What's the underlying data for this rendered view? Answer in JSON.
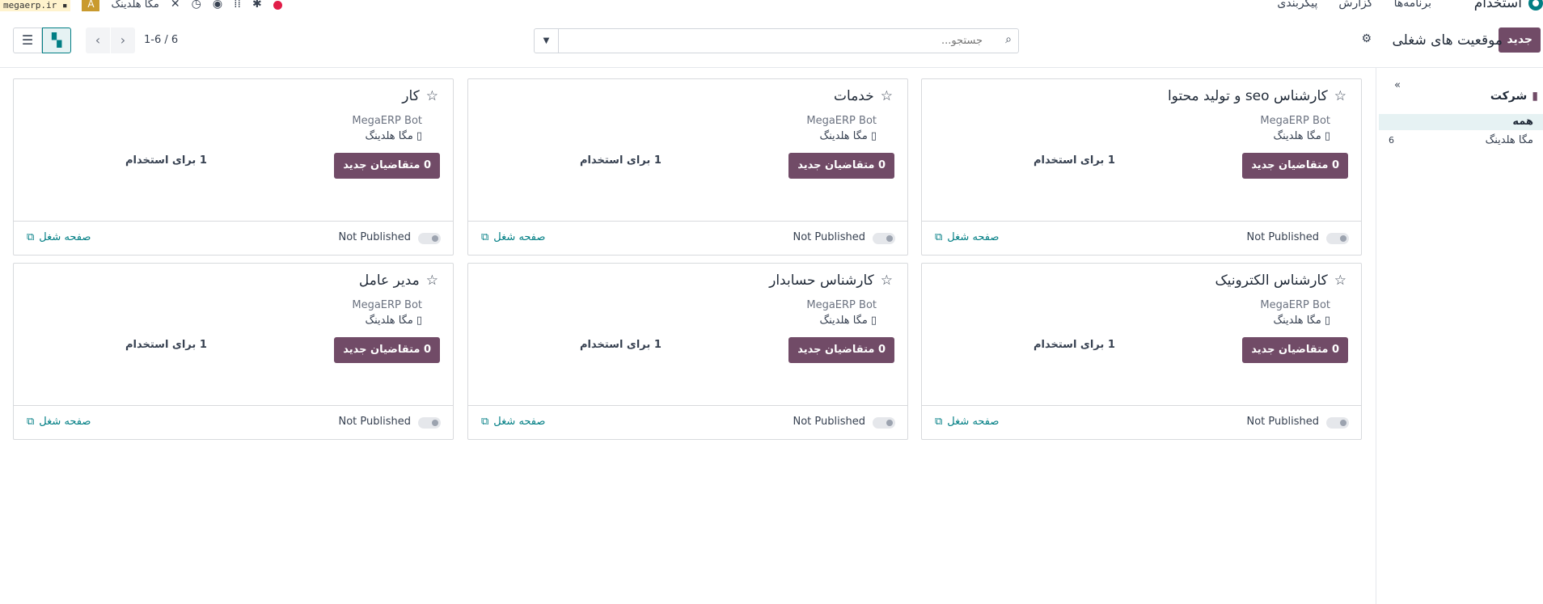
{
  "navbar": {
    "app_title": "استخدام",
    "menu": [
      "برنامه‌ها",
      "گزارش",
      "پیکربندی"
    ],
    "domain": "megaerp.ir",
    "avatar": "A",
    "company": "مگا هلدینگ"
  },
  "control_panel": {
    "new_button": "جدید",
    "breadcrumb": "موقعیت های شغلی",
    "search_placeholder": "جستجو...",
    "pager": "1-6 / 6"
  },
  "search_panel": {
    "header": "شرکت",
    "items": [
      {
        "label": "همه"
      },
      {
        "label": "مگا هلدینگ",
        "count": "6"
      }
    ]
  },
  "jobs": [
    {
      "name": "کارشناس seo و تولید محتوا",
      "owner": "MegaERP Bot",
      "company": "مگا هلدینگ",
      "applicants": "0 متقاضیان جدید",
      "to_recruit": "1 برای استخدام",
      "published": "Not Published",
      "job_page": "صفحه شغل"
    },
    {
      "name": "خدمات",
      "owner": "MegaERP Bot",
      "company": "مگا هلدینگ",
      "applicants": "0 متقاضیان جدید",
      "to_recruit": "1 برای استخدام",
      "published": "Not Published",
      "job_page": "صفحه شغل"
    },
    {
      "name": "کار",
      "owner": "MegaERP Bot",
      "company": "مگا هلدینگ",
      "applicants": "0 متقاضیان جدید",
      "to_recruit": "1 برای استخدام",
      "published": "Not Published",
      "job_page": "صفحه شغل"
    },
    {
      "name": "کارشناس الکترونیک",
      "owner": "MegaERP Bot",
      "company": "مگا هلدینگ",
      "applicants": "0 متقاضیان جدید",
      "to_recruit": "1 برای استخدام",
      "published": "Not Published",
      "job_page": "صفحه شغل"
    },
    {
      "name": "کارشناس حسابدار",
      "owner": "MegaERP Bot",
      "company": "مگا هلدینگ",
      "applicants": "0 متقاضیان جدید",
      "to_recruit": "1 برای استخدام",
      "published": "Not Published",
      "job_page": "صفحه شغل"
    },
    {
      "name": "مدیر عامل",
      "owner": "MegaERP Bot",
      "company": "مگا هلدینگ",
      "applicants": "0 متقاضیان جدید",
      "to_recruit": "1 برای استخدام",
      "published": "Not Published",
      "job_page": "صفحه شغل"
    }
  ],
  "colors": {
    "primary": "#714b67",
    "link": "#017e84"
  }
}
